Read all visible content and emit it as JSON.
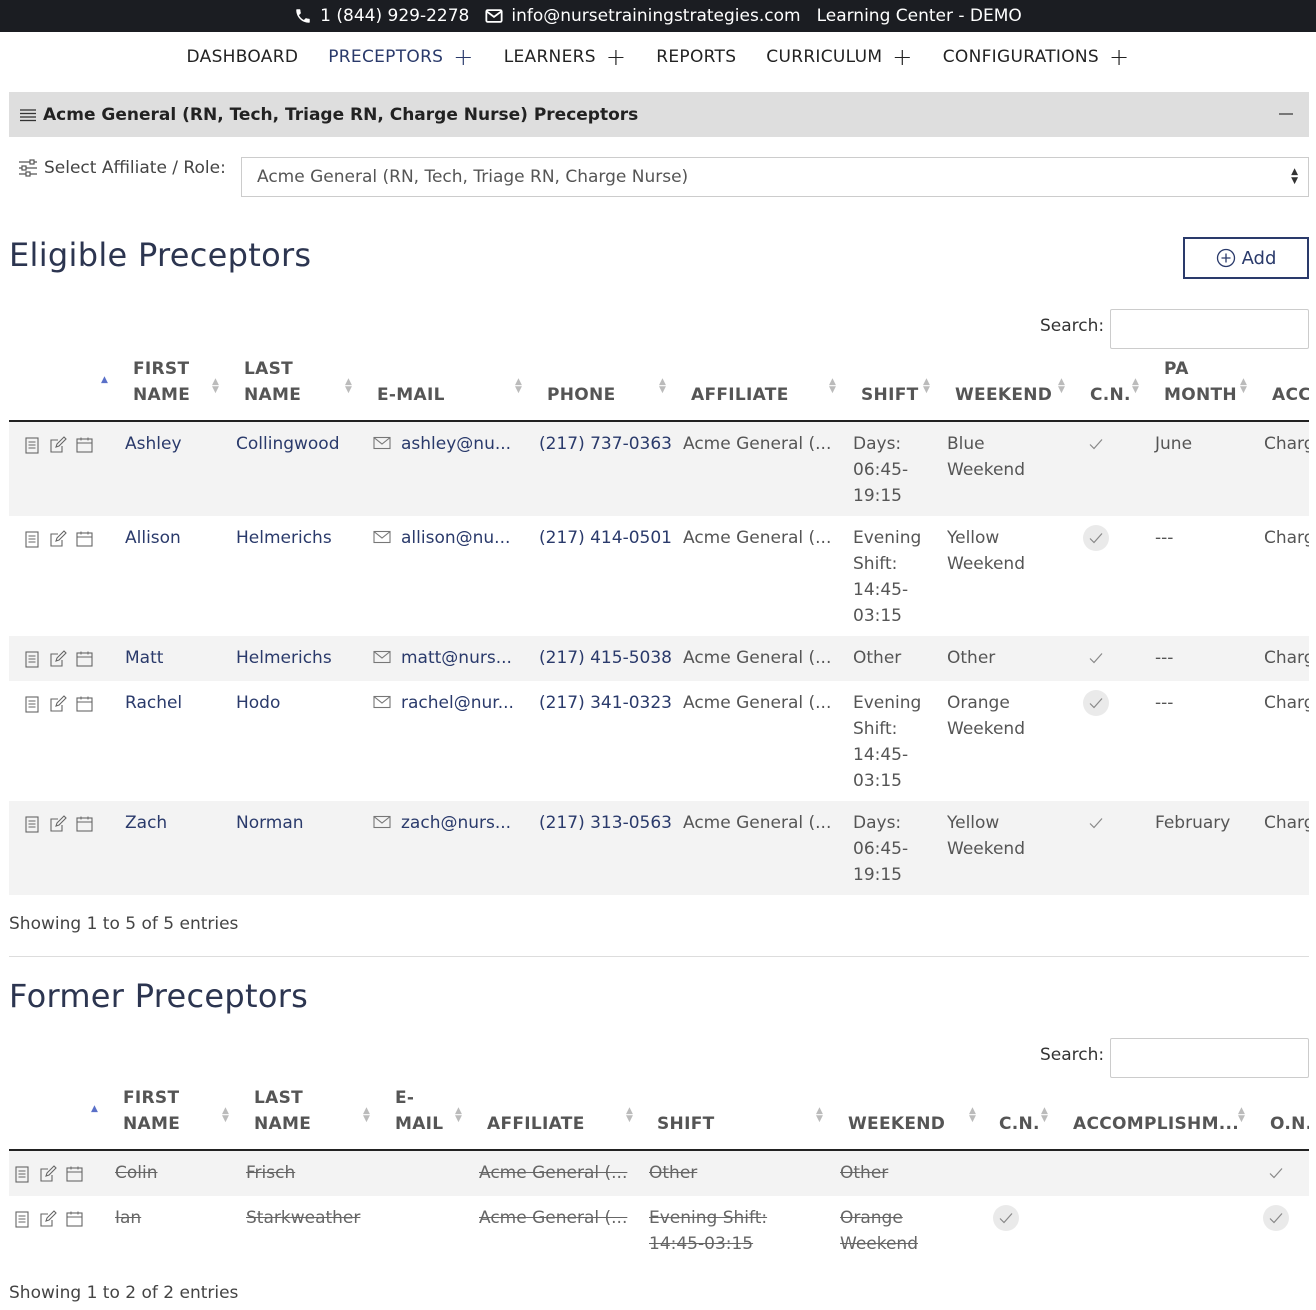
{
  "topbar": {
    "phone": "1 (844) 929-2278",
    "email": "info@nursetrainingstrategies.com",
    "site": "Learning Center - DEMO"
  },
  "nav": [
    {
      "label": "DASHBOARD",
      "plus": false
    },
    {
      "label": "PRECEPTORS",
      "plus": true,
      "active": true
    },
    {
      "label": "LEARNERS",
      "plus": true
    },
    {
      "label": "REPORTS",
      "plus": false
    },
    {
      "label": "CURRICULUM",
      "plus": true
    },
    {
      "label": "CONFIGURATIONS",
      "plus": true
    }
  ],
  "panel": {
    "title": "Acme General (RN, Tech, Triage RN, Charge Nurse) Preceptors"
  },
  "affiliate": {
    "label": "Select Affiliate / Role:",
    "selected": "Acme General (RN, Tech, Triage RN, Charge Nurse)"
  },
  "eligible": {
    "title": "Eligible Preceptors",
    "add_label": "Add",
    "search_label": "Search:",
    "headers": [
      "FIRST\nNAME",
      "LAST\nNAME",
      "E-MAIL",
      "PHONE",
      "AFFILIATE",
      "SHIFT",
      "WEEKEND",
      "C.N.",
      "PA\nMONTH",
      "ACC"
    ],
    "rows": [
      {
        "first": "Ashley",
        "last": "Collingwood",
        "email": "ashley@nu...",
        "phone": "(217) 737-0363",
        "affiliate": "Acme General (...",
        "shift": "Days:\n06:45-\n19:15",
        "weekend": "Blue\nWeekend",
        "cn": true,
        "pa": "June",
        "acc": "Charg"
      },
      {
        "first": "Allison",
        "last": "Helmerichs",
        "email": "allison@nu...",
        "phone": "(217) 414-0501",
        "affiliate": "Acme General (...",
        "shift": "Evening\nShift:\n14:45-\n03:15",
        "weekend": "Yellow\nWeekend",
        "cn": true,
        "pa": "---",
        "acc": "Charg"
      },
      {
        "first": "Matt",
        "last": "Helmerichs",
        "email": "matt@nurs...",
        "phone": "(217) 415-5038",
        "affiliate": "Acme General (...",
        "shift": "Other",
        "weekend": "Other",
        "cn": true,
        "pa": "---",
        "acc": "Charg"
      },
      {
        "first": "Rachel",
        "last": "Hodo",
        "email": "rachel@nur...",
        "phone": "(217) 341-0323",
        "affiliate": "Acme General (...",
        "shift": "Evening\nShift:\n14:45-\n03:15",
        "weekend": "Orange\nWeekend",
        "cn": true,
        "pa": "---",
        "acc": "Charg"
      },
      {
        "first": "Zach",
        "last": "Norman",
        "email": "zach@nurs...",
        "phone": "(217) 313-0563",
        "affiliate": "Acme General (...",
        "shift": "Days:\n06:45-\n19:15",
        "weekend": "Yellow\nWeekend",
        "cn": true,
        "pa": "February",
        "acc": "Charg"
      }
    ],
    "info": "Showing 1 to 5 of 5 entries"
  },
  "former": {
    "title": "Former Preceptors",
    "search_label": "Search:",
    "headers": [
      "FIRST\nNAME",
      "LAST\nNAME",
      "E-\nMAIL",
      "AFFILIATE",
      "SHIFT",
      "WEEKEND",
      "C.N.",
      "ACCOMPLISHM...",
      "O.N."
    ],
    "rows": [
      {
        "first": "Colin",
        "last": "Frisch",
        "affiliate": "Acme General (...",
        "shift": "Other",
        "weekend": "Other",
        "cn": false,
        "on": true
      },
      {
        "first": "Ian",
        "last": "Starkweather",
        "affiliate": "Acme General (...",
        "shift": "Evening Shift:\n14:45-03:15",
        "weekend": "Orange\nWeekend",
        "cn": true,
        "on": true
      }
    ],
    "info": "Showing 1 to 2 of 2 entries"
  }
}
